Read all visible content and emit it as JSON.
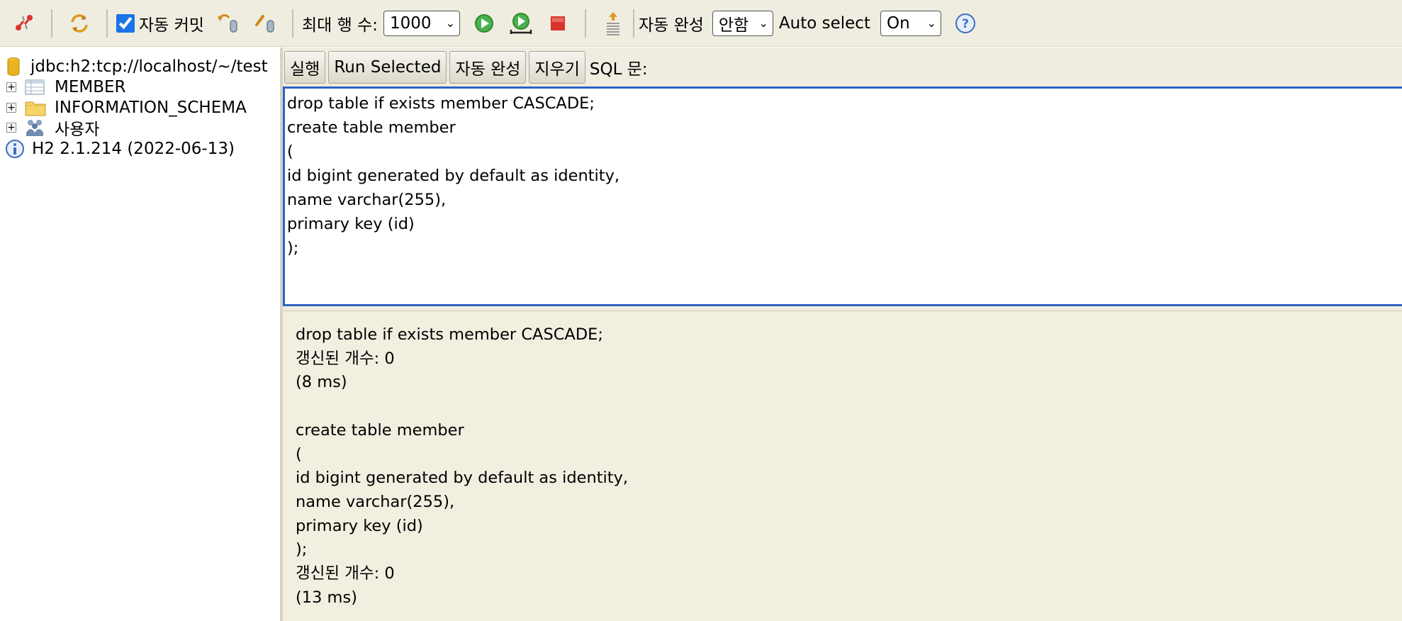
{
  "toolbar": {
    "autocommit_label": "자동 커밋",
    "max_rows_label": "최대 행 수:",
    "max_rows_value": "1000",
    "autocomplete_label": "자동 완성",
    "autocomplete_value": "안함",
    "auto_select_label": "Auto select",
    "auto_select_value": "On"
  },
  "tree": {
    "connection": "jdbc:h2:tcp://localhost/~/test",
    "items": [
      {
        "label": "MEMBER"
      },
      {
        "label": "INFORMATION_SCHEMA"
      },
      {
        "label": "사용자"
      }
    ],
    "version": "H2 2.1.214 (2022-06-13)"
  },
  "cmdbar": {
    "run": "실행",
    "run_selected": "Run Selected",
    "autocomplete": "자동 완성",
    "clear": "지우기",
    "sql_label": "SQL 문:"
  },
  "editor": {
    "lines": [
      "drop table if exists member CASCADE;",
      "create table member",
      "(",
      "id bigint generated by default as identity,",
      "name varchar(255),",
      "primary key (id)",
      ");"
    ]
  },
  "results": {
    "lines": [
      "drop table if exists member CASCADE;",
      "갱신된 개수: 0",
      "(8 ms)",
      "",
      "create table member",
      "(",
      "id bigint generated by default as identity,",
      "name varchar(255),",
      "primary key (id)",
      ");",
      "갱신된 개수: 0",
      "(13 ms)"
    ]
  }
}
